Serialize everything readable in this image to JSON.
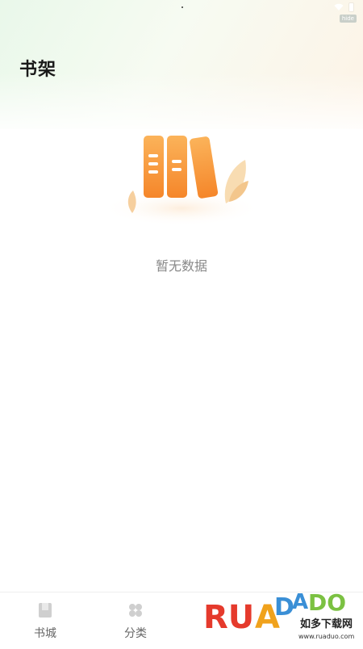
{
  "page": {
    "title": "书架"
  },
  "status": {
    "tag": "hide"
  },
  "empty_state": {
    "message": "暂无数据"
  },
  "tabs": [
    {
      "label": "书城",
      "icon": "book-icon"
    },
    {
      "label": "分类",
      "icon": "category-icon"
    }
  ],
  "watermark": {
    "brand": "RUANDADO",
    "subtitle": "如多下载网",
    "url": "www.ruaduo.com"
  },
  "colors": {
    "accent": "#f58a2c",
    "accent_light": "#fbb35a",
    "leaf": "#f6cf9e",
    "text_primary": "#1a1a1a",
    "text_secondary": "#888888"
  }
}
